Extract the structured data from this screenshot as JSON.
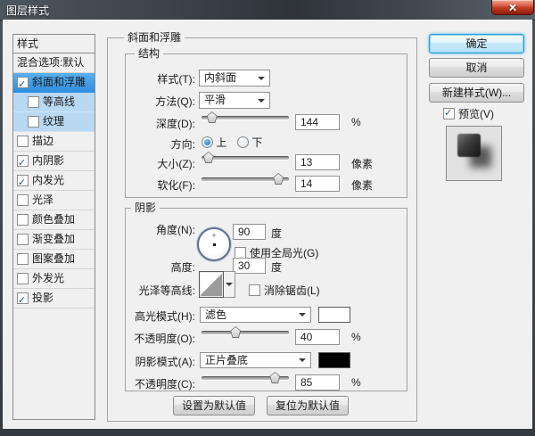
{
  "window": {
    "title": "图层样式"
  },
  "colors": {
    "selected_row": "#3d9ded",
    "sub_row": "#b9d9f3",
    "titlebar": "#3a4147",
    "close_button_red": "#c03a22",
    "highlight_swatch": "#ffffff",
    "shadow_swatch": "#000000"
  },
  "sidebar": {
    "header": "样式",
    "items": [
      {
        "label": "混合选项:默认",
        "checkbox": null,
        "state": ""
      },
      {
        "label": "斜面和浮雕",
        "checkbox": true,
        "state": "selected"
      },
      {
        "label": "等高线",
        "checkbox": false,
        "state": "sub"
      },
      {
        "label": "纹理",
        "checkbox": false,
        "state": "sub"
      },
      {
        "label": "描边",
        "checkbox": false,
        "state": ""
      },
      {
        "label": "内阴影",
        "checkbox": true,
        "state": ""
      },
      {
        "label": "内发光",
        "checkbox": true,
        "state": ""
      },
      {
        "label": "光泽",
        "checkbox": false,
        "state": ""
      },
      {
        "label": "颜色叠加",
        "checkbox": false,
        "state": ""
      },
      {
        "label": "渐变叠加",
        "checkbox": false,
        "state": ""
      },
      {
        "label": "图案叠加",
        "checkbox": false,
        "state": ""
      },
      {
        "label": "外发光",
        "checkbox": false,
        "state": ""
      },
      {
        "label": "投影",
        "checkbox": true,
        "state": ""
      }
    ]
  },
  "panel": {
    "title": "斜面和浮雕",
    "structure": {
      "title": "结构",
      "style_label": "样式(T):",
      "style_value": "内斜面",
      "technique_label": "方法(Q):",
      "technique_value": "平滑",
      "depth_label": "深度(D):",
      "depth_value": "144",
      "depth_unit": "%",
      "depth_percent": 12,
      "direction_label": "方向:",
      "direction_up": "上",
      "direction_down": "下",
      "direction_up_selected": true,
      "size_label": "大小(Z):",
      "size_value": "13",
      "size_unit": "像素",
      "size_percent": 8,
      "soften_label": "软化(F):",
      "soften_value": "14",
      "soften_unit": "像素",
      "soften_percent": 88
    },
    "shading": {
      "title": "阴影",
      "angle_label": "角度(N):",
      "angle_value": "90",
      "angle_unit": "度",
      "global_light_label": "使用全局光(G)",
      "global_light_checked": false,
      "altitude_label": "高度:",
      "altitude_value": "30",
      "altitude_unit": "度",
      "gloss_contour_label": "光泽等高线:",
      "anti_alias_label": "消除锯齿(L)",
      "anti_alias_checked": false,
      "highlight_mode_label": "高光模式(H):",
      "highlight_mode_value": "滤色",
      "highlight_color": "#ffffff",
      "highlight_opacity_label": "不透明度(O):",
      "highlight_opacity_value": "40",
      "highlight_opacity_unit": "%",
      "highlight_opacity_percent": 39,
      "shadow_mode_label": "阴影模式(A):",
      "shadow_mode_value": "正片叠底",
      "shadow_color": "#000000",
      "shadow_opacity_label": "不透明度(C):",
      "shadow_opacity_value": "85",
      "shadow_opacity_unit": "%",
      "shadow_opacity_percent": 84
    },
    "footer": {
      "set_default": "设置为默认值",
      "reset_default": "复位为默认值"
    }
  },
  "actions": {
    "ok": "确定",
    "cancel": "取消",
    "new_style": "新建样式(W)...",
    "preview": "预览(V)",
    "preview_checked": true
  }
}
